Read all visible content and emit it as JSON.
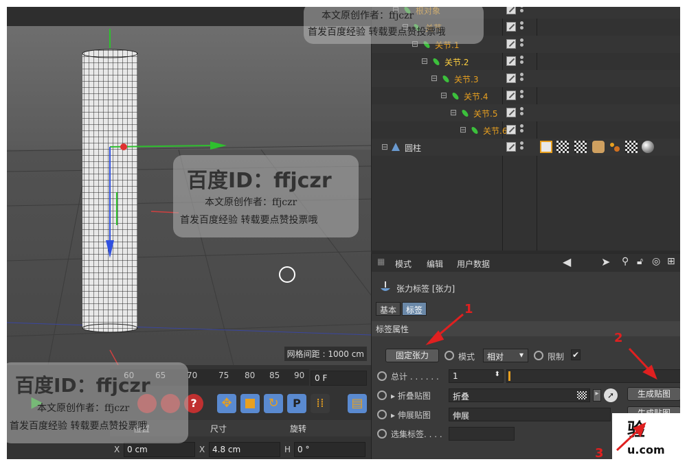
{
  "viewport": {
    "grid_readout": "网格间距 : 1000 cm"
  },
  "object_manager": {
    "objects": [
      {
        "name": "根对象",
        "color": "#e8a020"
      },
      {
        "name": "关节",
        "color": "#e8a020"
      },
      {
        "name": "关节.1",
        "color": "#e8a020"
      },
      {
        "name": "关节.2",
        "color": "#ffd040"
      },
      {
        "name": "关节.3",
        "color": "#e8a020"
      },
      {
        "name": "关节.4",
        "color": "#e8a020"
      },
      {
        "name": "关节.5",
        "color": "#e8a020"
      },
      {
        "name": "关节.6",
        "color": "#e8a020"
      },
      {
        "name": "圆柱",
        "color": "#dddddd"
      }
    ]
  },
  "attribute_manager": {
    "menu": [
      "模式",
      "编辑",
      "用户数据"
    ],
    "tag_title": "张力标签 [张力]",
    "tabs": [
      "基本",
      "标签"
    ],
    "section": "标签属性",
    "fixed_tension_btn": "固定张力",
    "mode_label": "模式",
    "mode_value": "相对",
    "limit_label": "限制",
    "limit_check": "✔",
    "total_label": "总计 . . . . . .",
    "total_value": "1",
    "fold_map_label": "折叠贴图",
    "fold_map_value": "折叠",
    "stretch_map_label": "伸展贴图",
    "stretch_map_value": "伸展",
    "selection_tag_label": "选集标签. . . .",
    "generate_btn_1": "生成贴图",
    "generate_btn_2": "生成贴图"
  },
  "timeline": {
    "ticks": [
      "60",
      "65",
      "70",
      "75",
      "80",
      "85",
      "90"
    ],
    "frame": "0 F"
  },
  "coordinates": {
    "headers": [
      "位置",
      "尺寸",
      "旋转"
    ],
    "x_pos": "0 cm",
    "x_size": "4.8 cm",
    "h_rot": "0 °",
    "label_x": "X",
    "label_h": "H"
  },
  "watermark": {
    "id_text": "百度ID：ffjczr",
    "author": "本文原创作者：ffjczr",
    "notice": "首发百度经验 转载要点赞投票哦",
    "brand_fragment": "验",
    "url_fragment": "u.com"
  },
  "annotations": [
    "1",
    "2",
    "3"
  ],
  "colors": {
    "accent_red": "#e02020",
    "orange": "#e8a020"
  }
}
